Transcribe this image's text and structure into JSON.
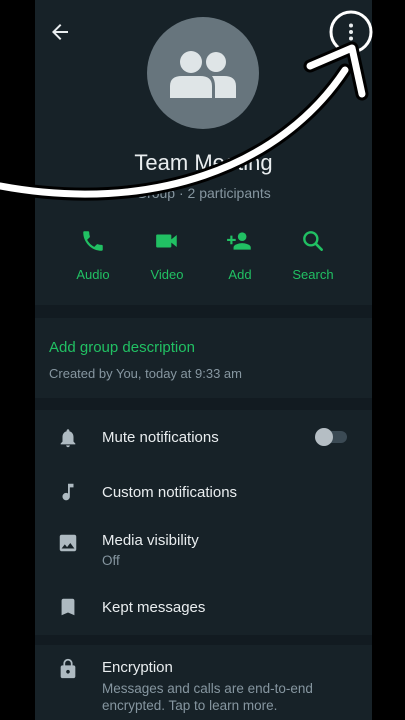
{
  "header": {
    "title": "Team Meeting",
    "subtitle": "Group · 2 participants"
  },
  "actions": [
    {
      "label": "Audio",
      "icon": "phone-icon"
    },
    {
      "label": "Video",
      "icon": "video-icon"
    },
    {
      "label": "Add",
      "icon": "add-person-icon"
    },
    {
      "label": "Search",
      "icon": "search-icon"
    }
  ],
  "description": {
    "add_label": "Add group description",
    "created": "Created by You, today at 9:33 am"
  },
  "settings": [
    {
      "label": "Mute notifications",
      "icon": "bell-icon",
      "toggle_on": false
    },
    {
      "label": "Custom notifications",
      "icon": "music-note-icon"
    },
    {
      "label": "Media visibility",
      "sublabel": "Off",
      "icon": "image-icon"
    },
    {
      "label": "Kept messages",
      "icon": "bookmark-icon"
    }
  ],
  "encryption": {
    "label": "Encryption",
    "sublabel": "Messages and calls are end-to-end encrypted. Tap to learn more.",
    "icon": "lock-icon"
  },
  "colors": {
    "accent": "#21c063",
    "background": "#121b21",
    "section": "#172228",
    "text_primary": "#e9edef",
    "text_secondary": "#8696a0"
  }
}
